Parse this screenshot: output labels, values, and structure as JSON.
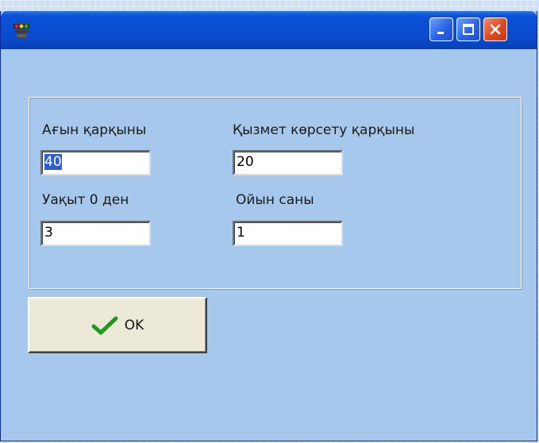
{
  "window": {
    "icon": "traffic-light-icon",
    "controls": [
      "minimize-icon",
      "maximize-icon",
      "close-icon"
    ]
  },
  "form": {
    "flow_rate": {
      "label": "Ағын қарқыны",
      "value": "40"
    },
    "service_rate": {
      "label": "Қызмет көрсету қарқыны",
      "value": "20"
    },
    "time": {
      "label": "Уақыт 0 ден",
      "value": "3"
    },
    "games": {
      "label": "Ойын саны",
      "value": "1"
    }
  },
  "ok_button": {
    "label": "OK",
    "icon": "checkmark-icon",
    "icon_color": "#1f9a1f"
  },
  "colors": {
    "titlebar": "#0a52d8",
    "client": "#a6c8ec",
    "close": "#e04a20",
    "selection": "#2b5fd0"
  }
}
